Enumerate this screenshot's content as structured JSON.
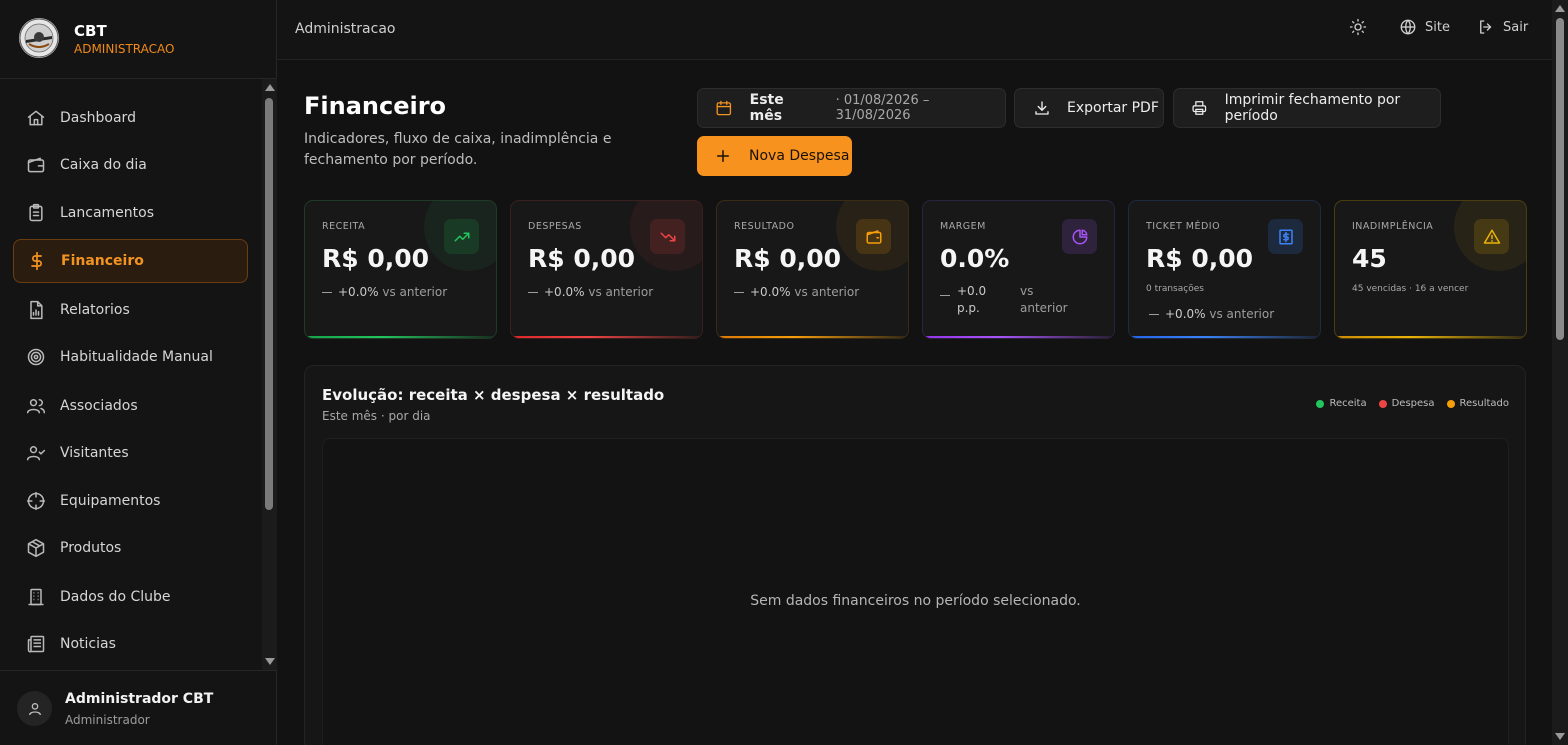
{
  "brand": {
    "title": "CBT",
    "subtitle": "ADMINISTRACAO"
  },
  "sidebar": {
    "items": [
      {
        "label": "Dashboard",
        "icon": "home-icon"
      },
      {
        "label": "Caixa do dia",
        "icon": "wallet-icon"
      },
      {
        "label": "Lancamentos",
        "icon": "clipboard-list-icon"
      },
      {
        "label": "Financeiro",
        "icon": "dollar-icon",
        "active": true
      },
      {
        "label": "Relatorios",
        "icon": "report-icon"
      },
      {
        "label": "Habitualidade Manual",
        "icon": "target-icon"
      },
      {
        "label": "Associados",
        "icon": "users-icon"
      },
      {
        "label": "Visitantes",
        "icon": "user-check-icon"
      },
      {
        "label": "Equipamentos",
        "icon": "crosshair-icon"
      },
      {
        "label": "Produtos",
        "icon": "package-icon"
      },
      {
        "label": "Dados do Clube",
        "icon": "building-icon"
      },
      {
        "label": "Noticias",
        "icon": "newspaper-icon"
      }
    ]
  },
  "user": {
    "name": "Administrador CBT",
    "role": "Administrador"
  },
  "topbar": {
    "breadcrumb": "Administracao",
    "site_label": "Site",
    "logout_label": "Sair"
  },
  "page": {
    "title": "Financeiro",
    "description": "Indicadores, fluxo de caixa, inadimplência e fechamento por período."
  },
  "toolbar": {
    "period_label": "Este mês",
    "period_range": "· 01/08/2026 – 31/08/2026",
    "export_label": "Exportar PDF",
    "print_label": "Imprimir fechamento por período",
    "new_expense_label": "Nova Despesa"
  },
  "kpis": [
    {
      "label": "RECEITA",
      "value": "R$ 0,00",
      "delta": "+0.0%",
      "vs": "vs anterior",
      "color": "#22c55e"
    },
    {
      "label": "DESPESAS",
      "value": "R$ 0,00",
      "delta": "+0.0%",
      "vs": "vs anterior",
      "color": "#ef4444"
    },
    {
      "label": "RESULTADO",
      "value": "R$ 0,00",
      "delta": "+0.0%",
      "vs": "vs anterior",
      "color": "#f59e0b"
    },
    {
      "label": "MARGEM",
      "value": "0.0%",
      "delta_line1": "+0.0",
      "delta_line2": "p.p.",
      "vs_line1": "vs",
      "vs_line2": "anterior",
      "color": "#a855f7"
    },
    {
      "label": "TICKET MÉDIO",
      "value": "R$ 0,00",
      "note": "0 transações",
      "delta": "+0.0%",
      "vs": "vs anterior",
      "color": "#3b82f6"
    },
    {
      "label": "INADIMPLÊNCIA",
      "value": "45",
      "note": "45 vencidas · 16 a vencer",
      "color": "#eab308"
    }
  ],
  "chart_panel": {
    "title": "Evolução: receita × despesa × resultado",
    "subtitle": "Este mês · por dia",
    "legend": [
      {
        "label": "Receita",
        "color": "#22c55e"
      },
      {
        "label": "Despesa",
        "color": "#ef4444"
      },
      {
        "label": "Resultado",
        "color": "#f59e0b"
      }
    ],
    "empty_message": "Sem dados financeiros no período selecionado."
  }
}
